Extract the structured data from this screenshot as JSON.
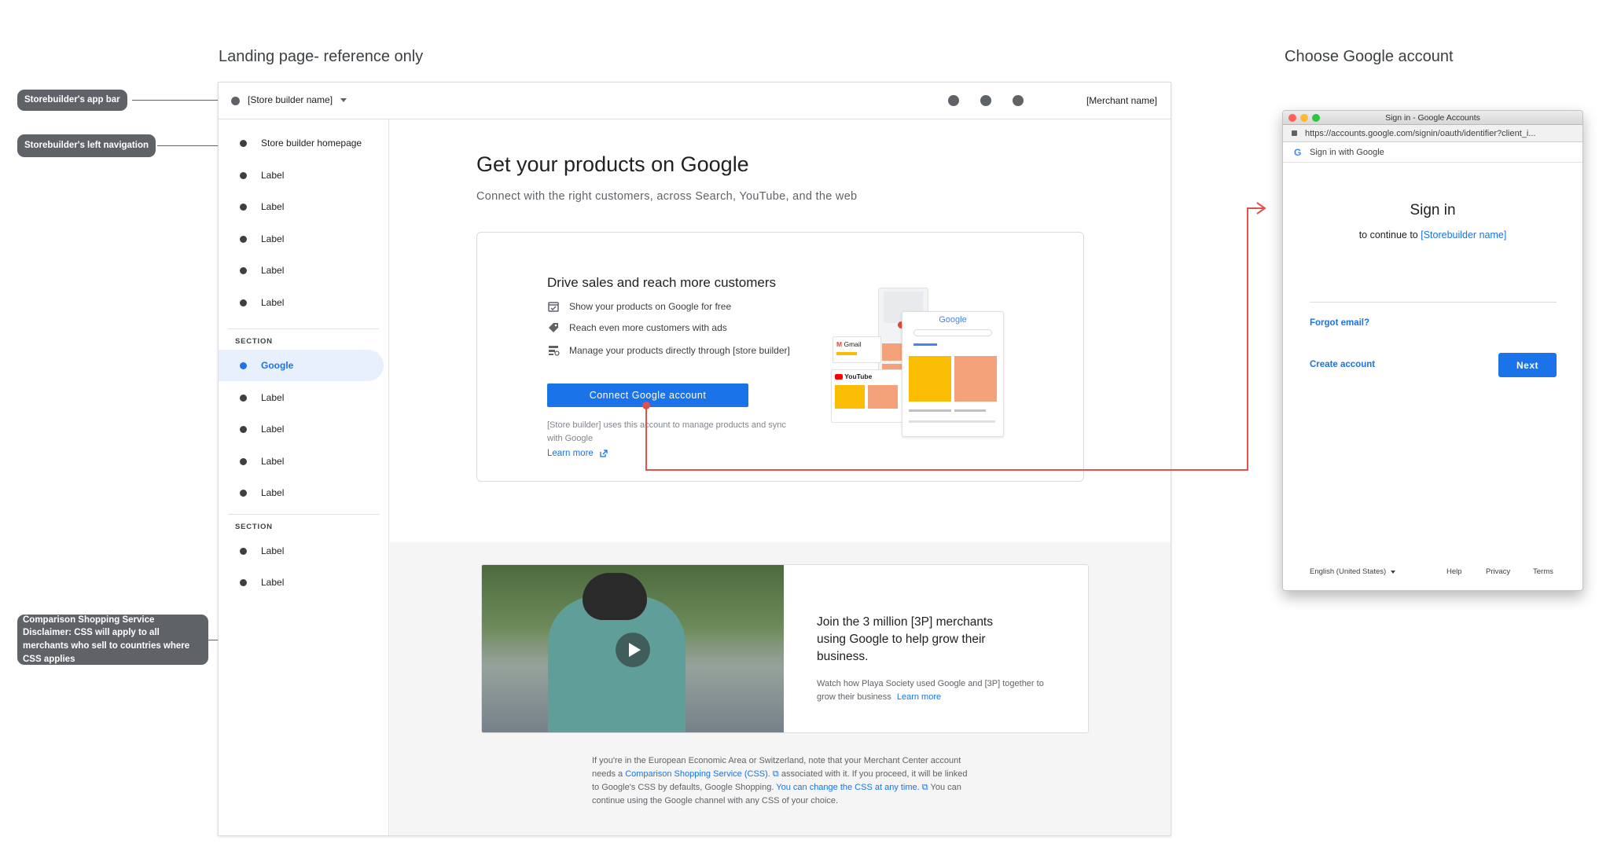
{
  "headings": {
    "landing": "Landing page- reference only",
    "choose": "Choose Google account"
  },
  "annotations": {
    "app_bar": "Storebuilder's app bar",
    "left_nav": "Storebuilder's left navigation",
    "css_disclaimer": "Comparison Shopping Service Disclaimer: CSS will apply to all merchants who sell to countries where CSS applies"
  },
  "appbar": {
    "store_name": "[Store builder name]",
    "merchant_name": "[Merchant name]"
  },
  "sidenav": {
    "items_top": [
      {
        "label": "Store builder homepage"
      },
      {
        "label": "Label"
      },
      {
        "label": "Label"
      },
      {
        "label": "Label"
      },
      {
        "label": "Label"
      },
      {
        "label": "Label"
      }
    ],
    "section1": "SECTION",
    "items_mid": [
      {
        "label": "Google",
        "active": true
      },
      {
        "label": "Label"
      },
      {
        "label": "Label"
      },
      {
        "label": "Label"
      },
      {
        "label": "Label"
      }
    ],
    "section2": "SECTION",
    "items_bottom": [
      {
        "label": "Label"
      },
      {
        "label": "Label"
      }
    ]
  },
  "hero": {
    "title": "Get your products on Google",
    "subtitle": "Connect with the right customers, across Search, YouTube, and the web"
  },
  "drive_card": {
    "title": "Drive sales and reach more customers",
    "features": [
      {
        "icon": "calendar-check-icon",
        "text": "Show your products on Google for free"
      },
      {
        "icon": "tag-plus-icon",
        "text": "Reach even more customers with ads"
      },
      {
        "icon": "list-settings-icon",
        "text": "Manage your products directly through [store builder]"
      }
    ],
    "button": "Connect Google account",
    "note": "[Store builder] uses this account to manage products and sync with Google",
    "learn_more": "Learn more",
    "illustration": {
      "gmail": "Gmail",
      "youtube": "YouTube",
      "google": "Google"
    }
  },
  "join_card": {
    "title": "Join the 3 million [3P] merchants using Google to help grow their business.",
    "desc": "Watch how Playa Society used Google and [3P] together to grow their business",
    "learn_more": "Learn more"
  },
  "disclaimer": {
    "p1": "If you're in the European Economic Area or Switzerland, note that your Merchant Center account needs a ",
    "link1": "Comparison Shopping Service (CSS).",
    "p2": " associated with it. If you proceed, it will be linked to Google's CSS by defaults, Google Shopping. ",
    "link2": "You can change the CSS at any time.",
    "p3": " You can continue using the Google channel with any CSS of your choice."
  },
  "signin": {
    "window_title": "Sign in - Google Accounts",
    "url": "https://accounts.google.com/signin/oauth/identifier?client_i...",
    "bar": "Sign in with Google",
    "title": "Sign in",
    "continue_prefix": "to continue to ",
    "continue_target": "[Storebuilder name]",
    "forgot": "Forgot email?",
    "create": "Create account",
    "next": "Next",
    "language": "English (United States)",
    "help": "Help",
    "privacy": "Privacy",
    "terms": "Terms"
  },
  "colors": {
    "primary": "#1a73e8",
    "annotation": "#5f6368",
    "connector": "#e0524f"
  }
}
